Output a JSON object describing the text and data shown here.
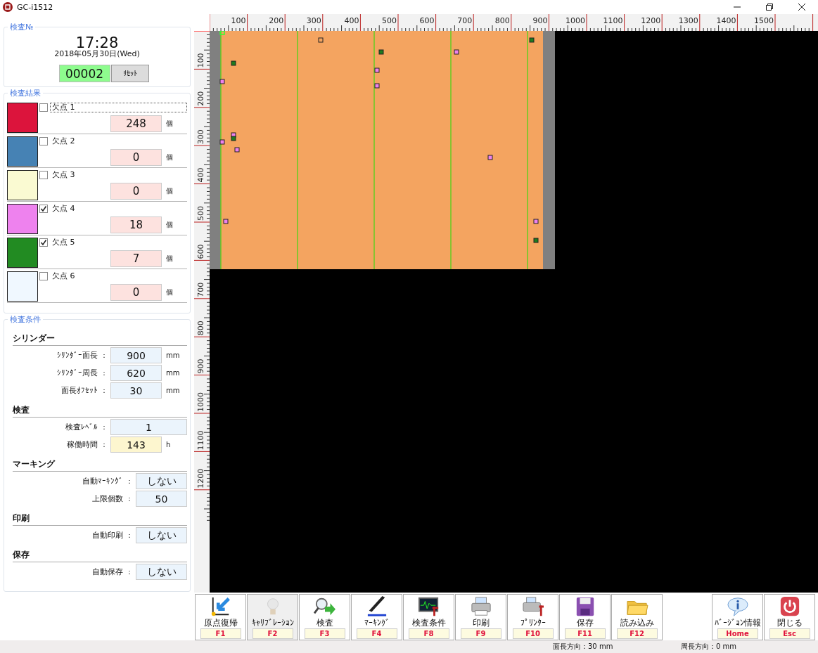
{
  "window": {
    "title": "GC-i1512"
  },
  "inspection_no": {
    "title": "検査№",
    "time": "17:28",
    "date": "2018年05月30日(Wed)",
    "counter": "00002",
    "reset_button": "ﾘｾｯﾄ"
  },
  "results": {
    "title": "検査結果",
    "defects": [
      {
        "label": "欠点 1",
        "color": "#dc143c",
        "checked": false,
        "focused": true,
        "count": "248",
        "unit": "個"
      },
      {
        "label": "欠点 2",
        "color": "#4682b4",
        "checked": false,
        "focused": false,
        "count": "0",
        "unit": "個"
      },
      {
        "label": "欠点 3",
        "color": "#fafad2",
        "checked": false,
        "focused": false,
        "count": "0",
        "unit": "個"
      },
      {
        "label": "欠点 4",
        "color": "#ee82ee",
        "checked": true,
        "focused": false,
        "count": "18",
        "unit": "個"
      },
      {
        "label": "欠点 5",
        "color": "#228b22",
        "checked": true,
        "focused": false,
        "count": "7",
        "unit": "個"
      },
      {
        "label": "欠点 6",
        "color": "#f0f8ff",
        "checked": false,
        "focused": false,
        "count": "0",
        "unit": "個"
      }
    ]
  },
  "conditions": {
    "title": "検査条件",
    "sections": [
      {
        "heading": "シリンダー",
        "rows": [
          {
            "kind": "numeric",
            "label": "ｼﾘﾝﾀﾞｰ面長",
            "separator": "：",
            "value": "900",
            "unit": "mm",
            "readonly": false
          },
          {
            "kind": "numeric",
            "label": "ｼﾘﾝﾀﾞｰ周長",
            "separator": "：",
            "value": "620",
            "unit": "mm",
            "readonly": false
          },
          {
            "kind": "numeric",
            "label": "面長ｵﾌｾｯﾄ",
            "separator": "：",
            "value": "30",
            "unit": "mm",
            "readonly": false
          }
        ]
      },
      {
        "heading": "検査",
        "rows": [
          {
            "kind": "wide",
            "label": "検査ﾚﾍﾞﾙ",
            "separator": "：",
            "value": "1",
            "readonly": false
          },
          {
            "kind": "numeric",
            "label": "稼働時間",
            "separator": "：",
            "value": "143",
            "unit": "h",
            "readonly": true
          }
        ]
      },
      {
        "heading": "マーキング",
        "rows": [
          {
            "kind": "option",
            "label": "自動ﾏｰｷﾝｸﾞ",
            "separator": "：",
            "value": "しない",
            "readonly": false
          },
          {
            "kind": "option",
            "label": "上限個数",
            "separator": "：",
            "value": "50",
            "readonly": false
          }
        ]
      },
      {
        "heading": "印刷",
        "rows": [
          {
            "kind": "option",
            "label": "自動印刷",
            "separator": "：",
            "value": "しない",
            "readonly": false
          }
        ]
      },
      {
        "heading": "保存",
        "rows": [
          {
            "kind": "option",
            "label": "自動保存",
            "separator": "：",
            "value": "しない",
            "readonly": false
          }
        ]
      }
    ]
  },
  "ruler": {
    "x_labels": [
      "100",
      "200",
      "300",
      "400",
      "500",
      "600",
      "700",
      "800",
      "900",
      "1000",
      "1100",
      "1200",
      "1300",
      "1400",
      "1500"
    ],
    "y_labels": [
      "100",
      "200",
      "300",
      "400",
      "500",
      "600",
      "700",
      "800",
      "900",
      "1000",
      "1100",
      "1200"
    ]
  },
  "toolbar": {
    "left": [
      {
        "label": "原点復帰",
        "key": "F1",
        "disabled": false
      },
      {
        "label": "ｷｬﾘﾌﾞﾚｰｼｮﾝ",
        "key": "F2",
        "disabled": true
      },
      {
        "label": "検査",
        "key": "F3",
        "disabled": false
      },
      {
        "label": "ﾏｰｷﾝｸﾞ",
        "key": "F4",
        "disabled": false
      },
      {
        "label": "検査条件",
        "key": "F8",
        "disabled": false
      },
      {
        "label": "印刷",
        "key": "F9",
        "disabled": false
      },
      {
        "label": "ﾌﾟﾘﾝﾀｰ",
        "key": "F10",
        "disabled": false
      },
      {
        "label": "保存",
        "key": "F11",
        "disabled": false
      },
      {
        "label": "読み込み",
        "key": "F12",
        "disabled": false
      }
    ],
    "right": [
      {
        "label": "ﾊﾞｰｼﾞｮﾝ情報",
        "key": "Home",
        "disabled": false
      },
      {
        "label": "閉じる",
        "key": "Esc",
        "disabled": false
      }
    ]
  },
  "status_bar": [
    "面長方向：30 mm",
    "周長方向：0 mm"
  ]
}
